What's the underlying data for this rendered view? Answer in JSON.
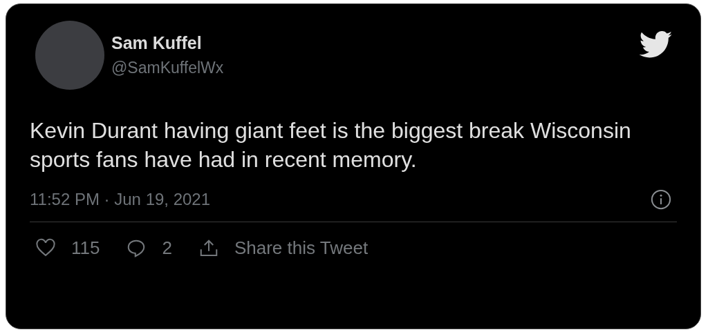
{
  "tweet": {
    "author": {
      "name": "Sam Kuffel",
      "handle": "@SamKuffelWx"
    },
    "text": "Kevin Durant having giant feet is the biggest break Wisconsin sports fans have had in recent memory.",
    "timestamp": "11:52 PM · Jun 19, 2021",
    "actions": [
      {
        "kind": "like",
        "label": "115"
      },
      {
        "kind": "reply",
        "label": "2"
      },
      {
        "kind": "share",
        "label": "Share this Tweet"
      }
    ]
  }
}
